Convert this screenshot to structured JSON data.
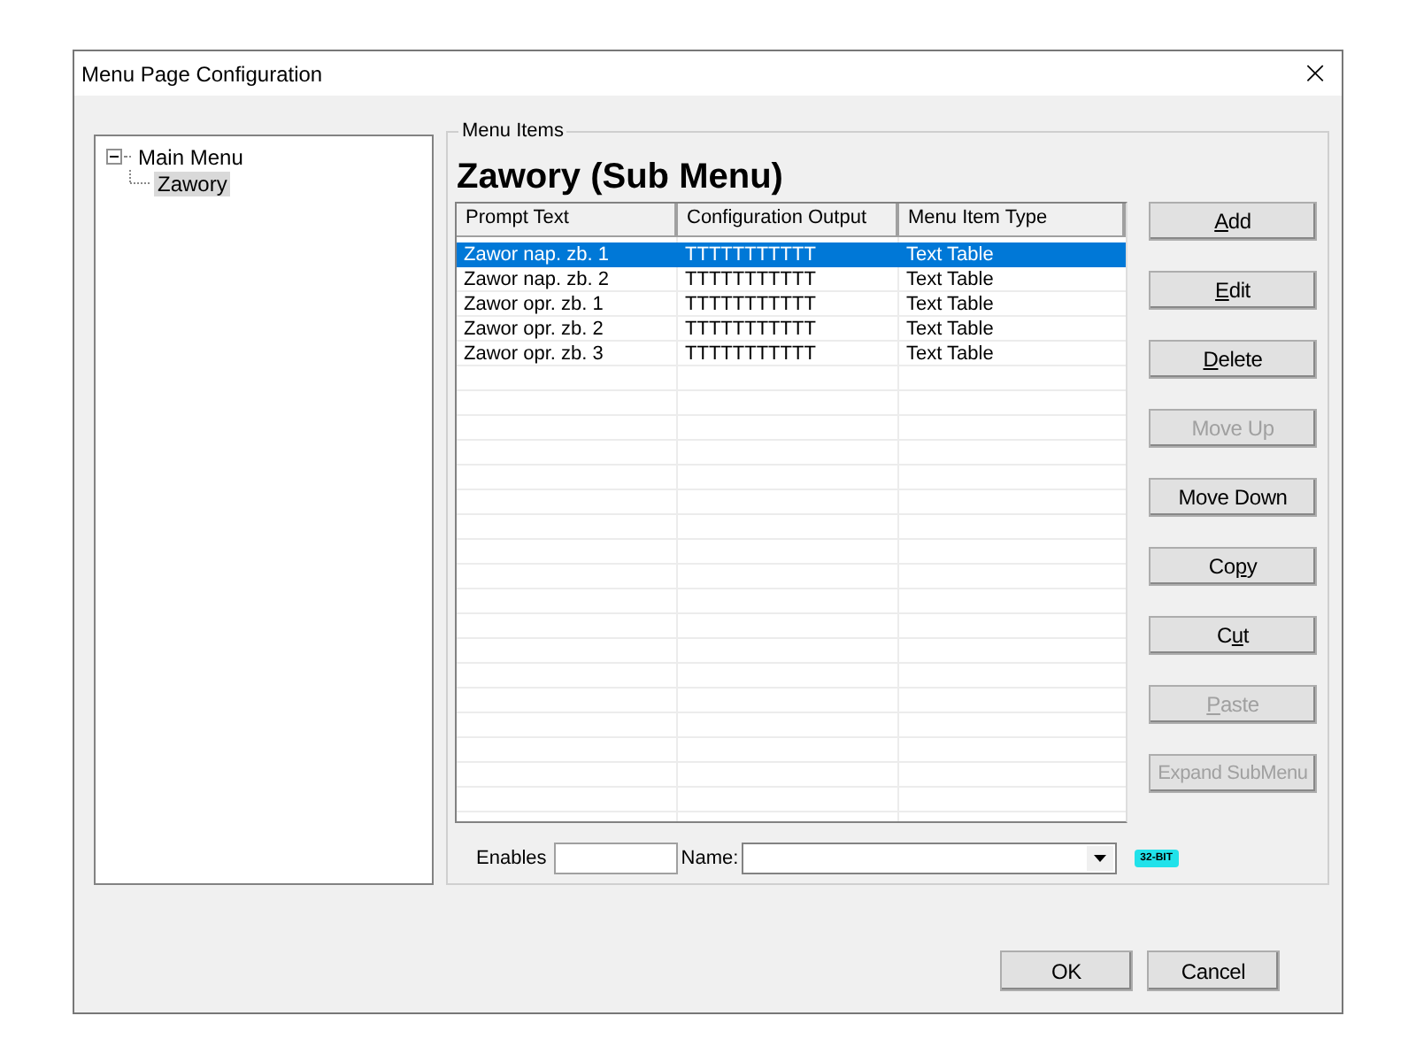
{
  "window": {
    "title": "Menu Page Configuration",
    "close": "×"
  },
  "tree": {
    "items": [
      {
        "label": "Main Menu",
        "expanded": true,
        "selected": false,
        "children": [
          {
            "label": "Zawory",
            "selected": true
          }
        ]
      }
    ]
  },
  "group": {
    "legend": "Menu Items",
    "heading": "Zawory (Sub Menu)"
  },
  "table": {
    "columns": [
      "Prompt Text",
      "Configuration Output",
      "Menu Item Type"
    ],
    "rows": [
      {
        "cells": [
          "Zawor nap. zb. 1",
          "TTTTTTTTTTT",
          "Text Table"
        ],
        "selected": true
      },
      {
        "cells": [
          "Zawor nap. zb. 2",
          "TTTTTTTTTTT",
          "Text Table"
        ],
        "selected": false
      },
      {
        "cells": [
          "Zawor opr. zb. 1",
          "TTTTTTTTTTT",
          "Text Table"
        ],
        "selected": false
      },
      {
        "cells": [
          "Zawor opr. zb. 2",
          "TTTTTTTTTTT",
          "Text Table"
        ],
        "selected": false
      },
      {
        "cells": [
          "Zawor opr. zb. 3",
          "TTTTTTTTTTT",
          "Text Table"
        ],
        "selected": false
      }
    ]
  },
  "side_buttons": [
    {
      "key": "A",
      "post": "dd",
      "disabled": false
    },
    {
      "key": "E",
      "post": "dit",
      "disabled": false
    },
    {
      "key": "D",
      "post": "elete",
      "disabled": false
    },
    {
      "pre": "Move Up",
      "disabled": true
    },
    {
      "pre": "Move Down",
      "disabled": false
    },
    {
      "pre": "Co",
      "key": "p",
      "post": "y",
      "disabled": false
    },
    {
      "pre": "C",
      "key": "u",
      "post": "t",
      "disabled": false
    },
    {
      "key": "P",
      "post": "aste",
      "disabled": true
    },
    {
      "pre": "Expand SubMenu",
      "disabled": true
    }
  ],
  "bottom": {
    "enables_label": "Enables",
    "name_label": "Name:",
    "badge": "32-BIT"
  },
  "footer_buttons": [
    "OK",
    "Cancel"
  ]
}
